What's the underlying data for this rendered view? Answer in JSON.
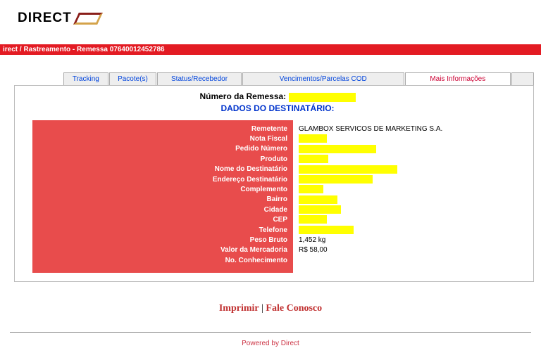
{
  "brand": {
    "name": "DIRECT"
  },
  "breadcrumb": "irect / Rastreamento - Remessa 07640012452786",
  "tabs": {
    "t1": "Tracking",
    "t2": "Pacote(s)",
    "t3": "Status/Recebedor",
    "t4": "Vencimentos/Parcelas COD",
    "t5": "Mais Informações",
    "t6": ""
  },
  "title": {
    "label": "Número da Remessa: "
  },
  "subtitle": "DADOS DO DESTINATÁRIO:",
  "labels": {
    "remetente": "Remetente",
    "nota": "Nota Fiscal",
    "pedido": "Pedido Número",
    "produto": "Produto",
    "nome": "Nome do Destinatário",
    "endereco": "Endereço Destinatário",
    "complemento": "Complemento",
    "bairro": "Bairro",
    "cidade": "Cidade",
    "cep": "CEP",
    "telefone": "Telefone",
    "peso": "Peso Bruto",
    "valor": "Valor da Mercadoria",
    "conhec": "No. Conhecimento"
  },
  "values": {
    "remetente": "GLAMBOX SERVICOS DE MARKETING S.A.",
    "peso": "1,452 kg",
    "valor": "R$ 58,00"
  },
  "footer": {
    "imprimir": "Imprimir",
    "fale": "Fale Conosco",
    "powered": "Powered by Direct"
  }
}
